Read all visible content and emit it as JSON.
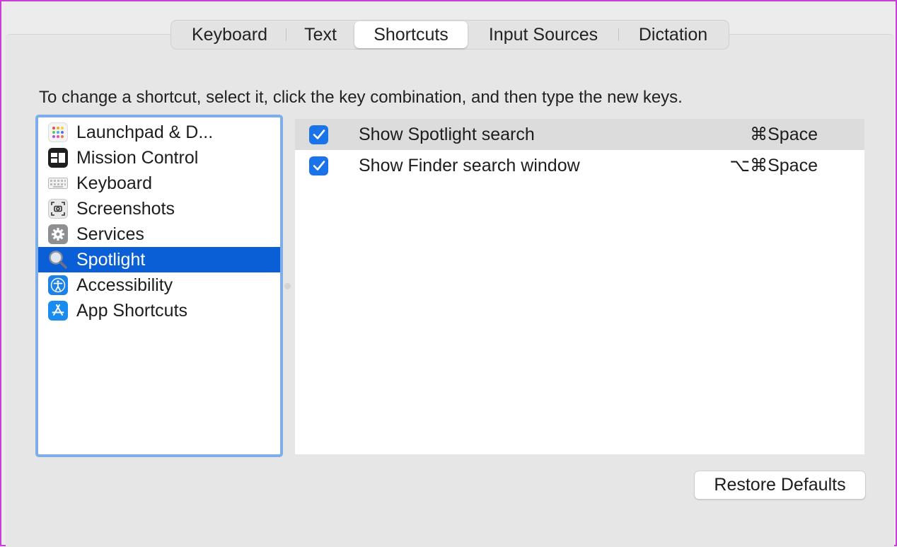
{
  "tabs": [
    {
      "label": "Keyboard",
      "active": false
    },
    {
      "label": "Text",
      "active": false
    },
    {
      "label": "Shortcuts",
      "active": true
    },
    {
      "label": "Input Sources",
      "active": false
    },
    {
      "label": "Dictation",
      "active": false
    }
  ],
  "instruction": "To change a shortcut, select it, click the key combination, and then type the new keys.",
  "sidebar": {
    "items": [
      {
        "label": "Launchpad & D...",
        "icon": "launchpad-icon",
        "selected": false
      },
      {
        "label": "Mission Control",
        "icon": "mission-control-icon",
        "selected": false
      },
      {
        "label": "Keyboard",
        "icon": "keyboard-icon",
        "selected": false
      },
      {
        "label": "Screenshots",
        "icon": "screenshot-icon",
        "selected": false
      },
      {
        "label": "Services",
        "icon": "gear-icon",
        "selected": false
      },
      {
        "label": "Spotlight",
        "icon": "magnifier-icon",
        "selected": true
      },
      {
        "label": "Accessibility",
        "icon": "accessibility-icon",
        "selected": false
      },
      {
        "label": "App Shortcuts",
        "icon": "app-store-icon",
        "selected": false
      }
    ]
  },
  "shortcuts": [
    {
      "label": "Show Spotlight search",
      "keys": "⌘Space",
      "checked": true
    },
    {
      "label": "Show Finder search window",
      "keys": "⌥⌘Space",
      "checked": true
    }
  ],
  "restore_button": "Restore Defaults",
  "colors": {
    "accent": "#0b5fd6",
    "checkbox": "#1a73e8",
    "focus_ring": "#7eaeea",
    "window_bg": "#e6e6e6"
  }
}
